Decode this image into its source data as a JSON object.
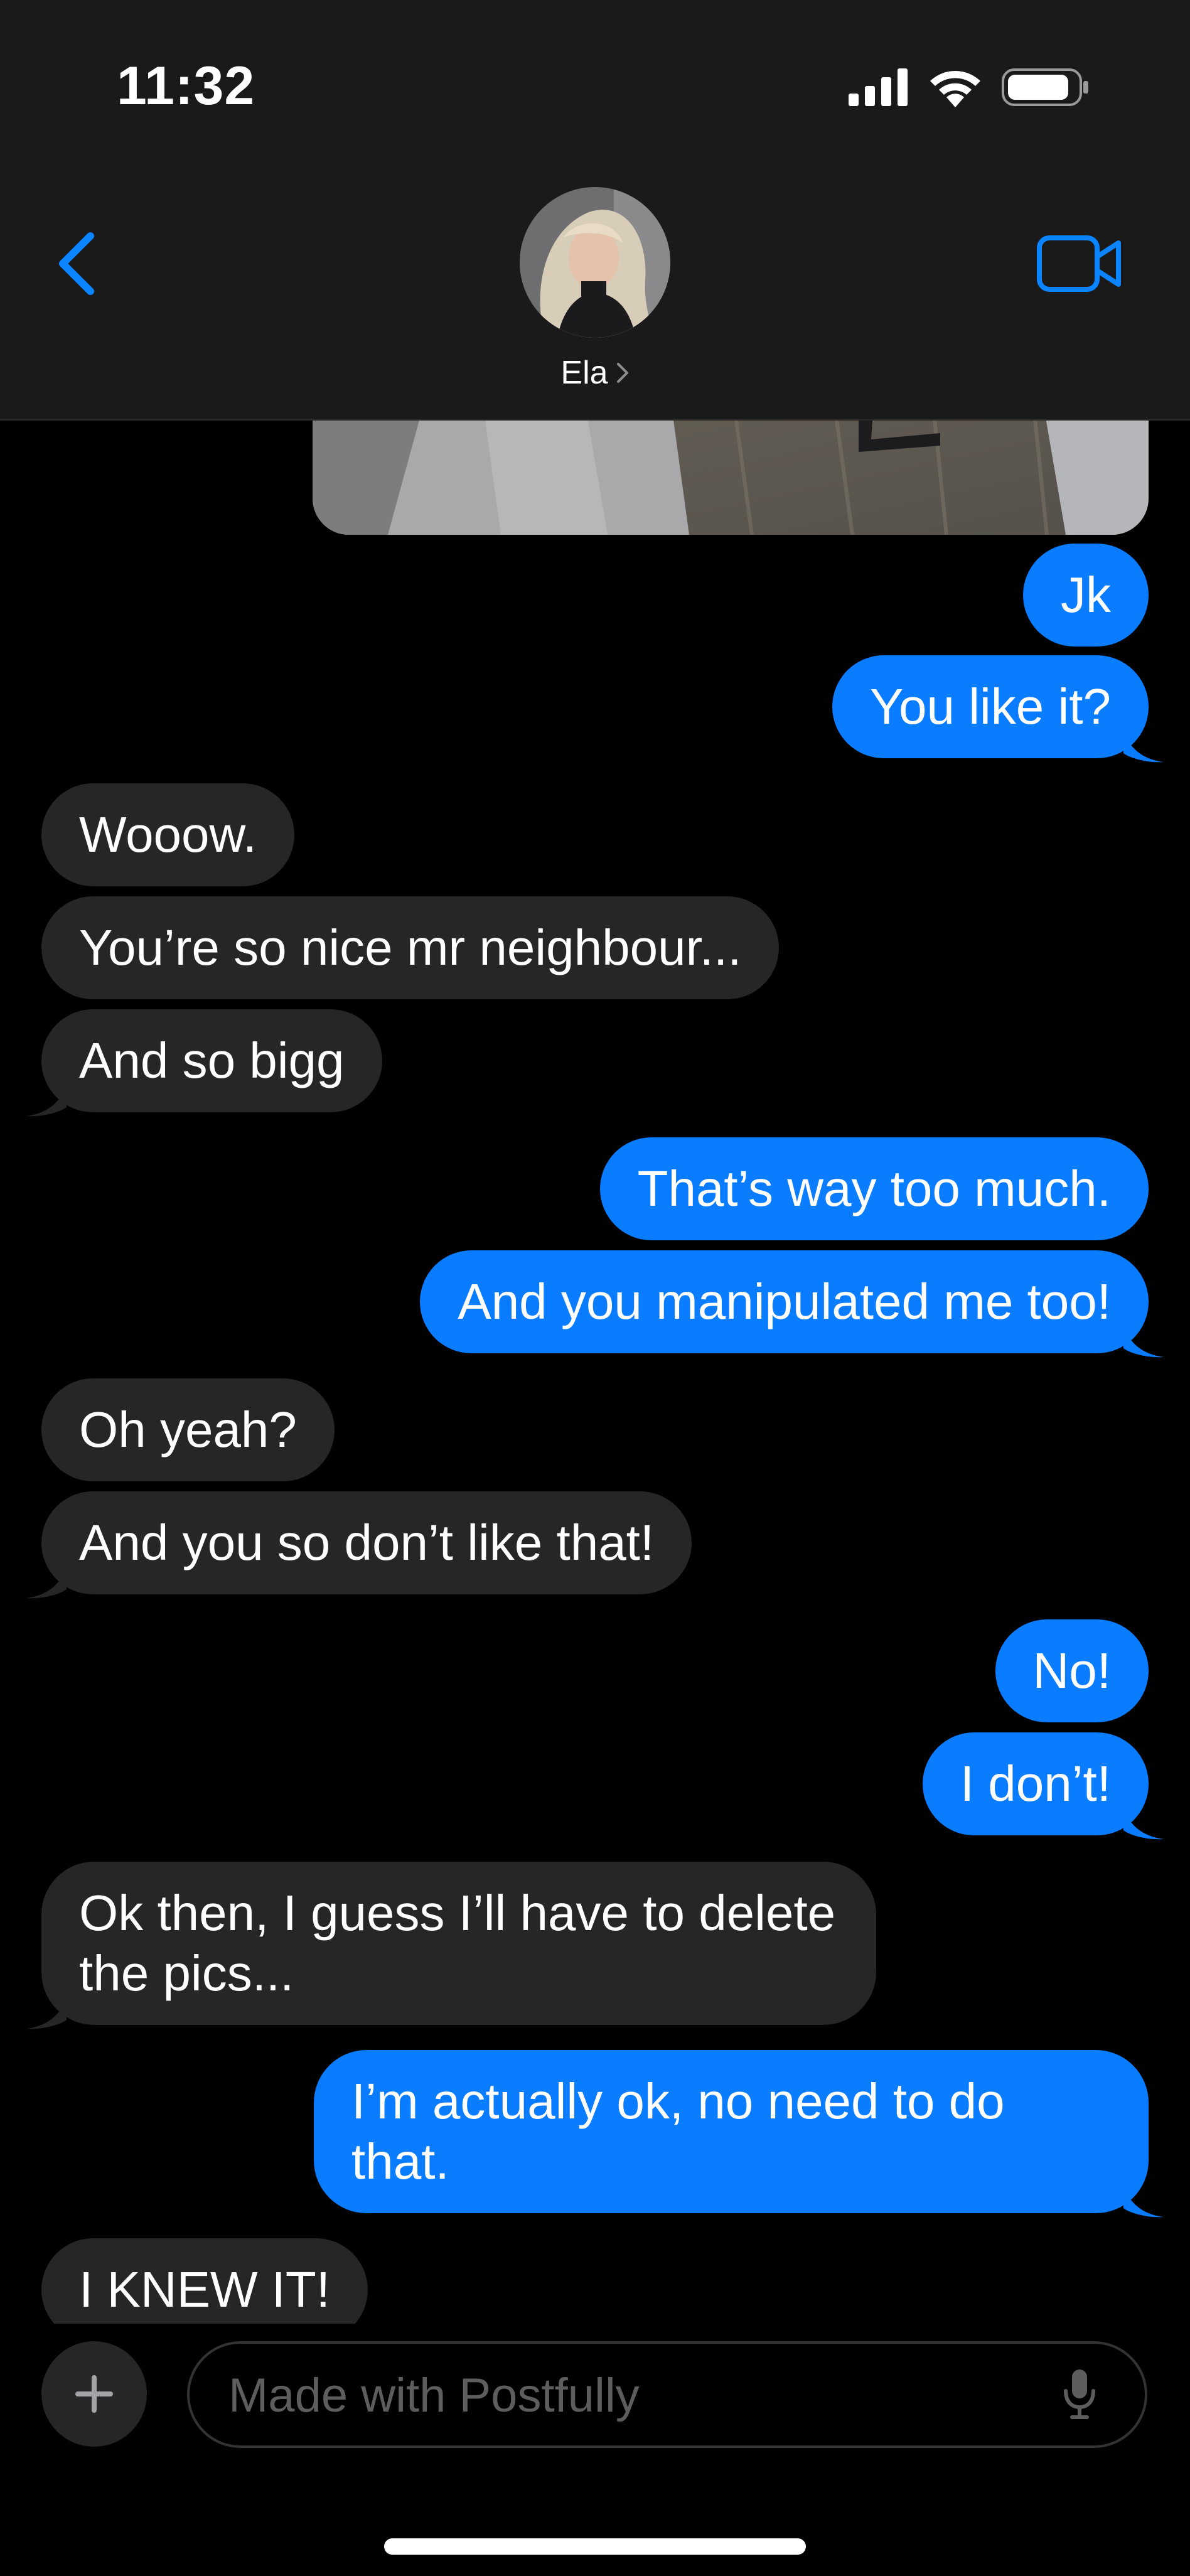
{
  "status_bar": {
    "time": "11:32",
    "icons": [
      "signal-icon",
      "wifi-icon",
      "battery-icon"
    ]
  },
  "header": {
    "contact_name": "Ela",
    "back_icon": "chevron-left-icon",
    "call_icon": "video-camera-icon"
  },
  "colors": {
    "sent_bubble": "#0a7cff",
    "received_bubble": "#262628",
    "accent": "#0a84ff",
    "background": "#000000"
  },
  "messages": [
    {
      "from": "me",
      "type": "photo"
    },
    {
      "from": "me",
      "text": "Jk"
    },
    {
      "from": "me",
      "text": "You like it?"
    },
    {
      "from": "them",
      "text": "Wooow."
    },
    {
      "from": "them",
      "text": "You’re so nice mr neighbour..."
    },
    {
      "from": "them",
      "text": "And so bigg"
    },
    {
      "from": "me",
      "text": "That’s way too much."
    },
    {
      "from": "me",
      "text": "And you manipulated me too!"
    },
    {
      "from": "them",
      "text": "Oh yeah?"
    },
    {
      "from": "them",
      "text": "And you so don’t like that!"
    },
    {
      "from": "me",
      "text": "No!"
    },
    {
      "from": "me",
      "text": "I don’t!"
    },
    {
      "from": "them",
      "text": "Ok then, I guess I’ll have to delete the pics..."
    },
    {
      "from": "me",
      "text": "I’m actually ok, no need to do that."
    },
    {
      "from": "them",
      "text": "I KNEW IT!"
    }
  ],
  "composer": {
    "plus_icon": "plus-icon",
    "placeholder": "Made with Postfully",
    "mic_icon": "microphone-icon"
  }
}
